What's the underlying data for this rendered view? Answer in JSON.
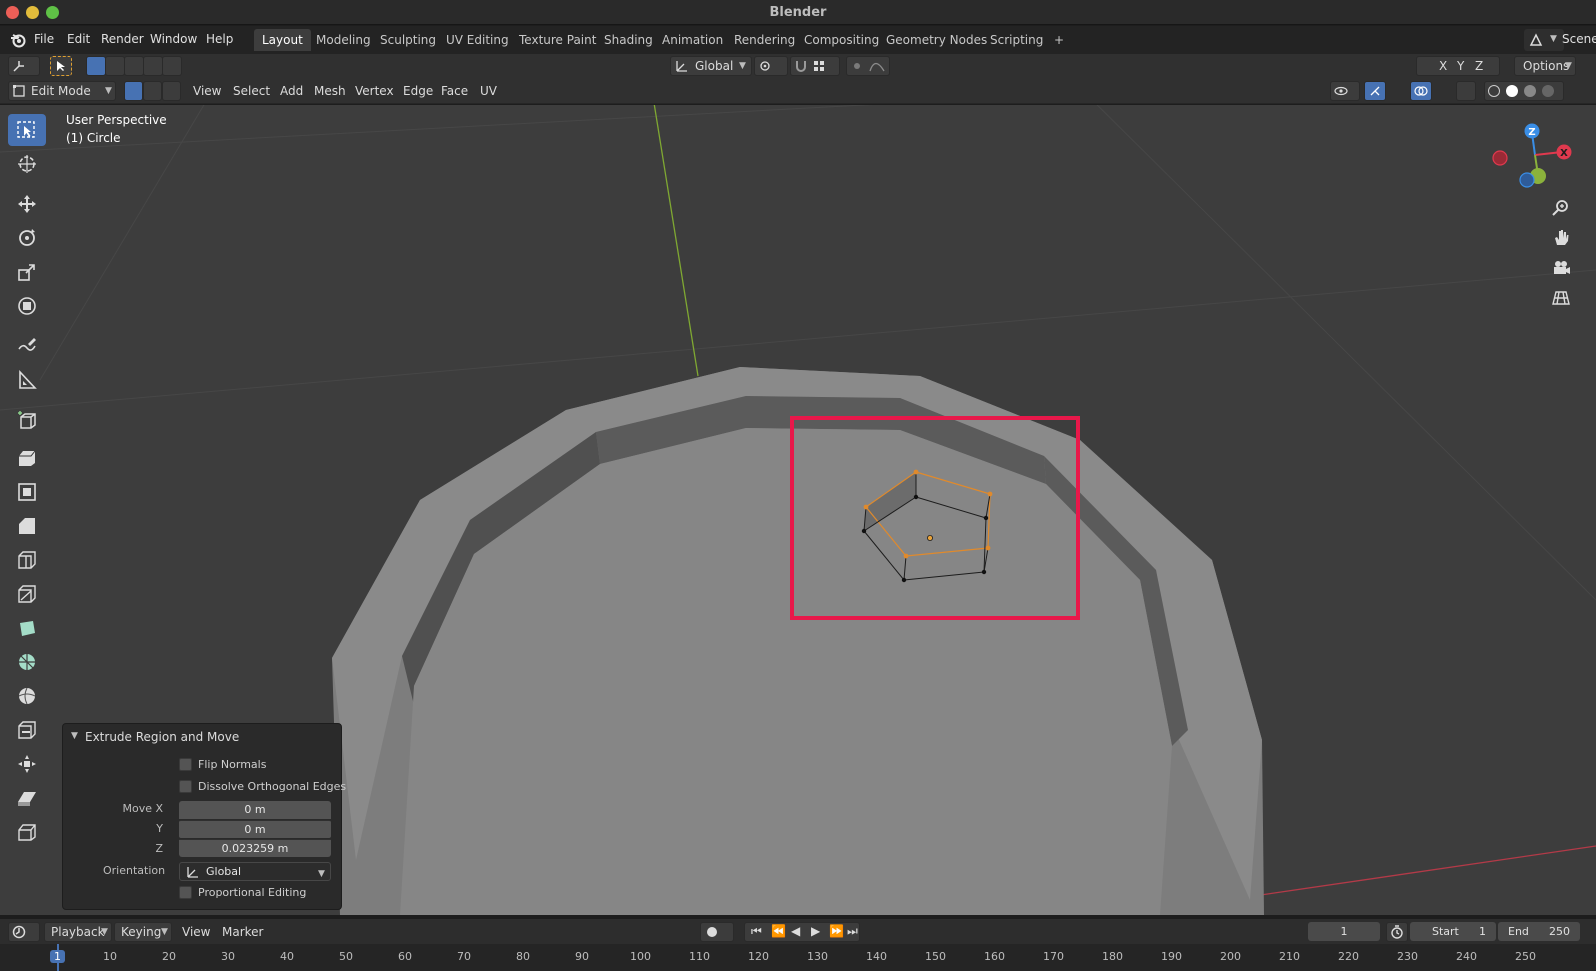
{
  "window": {
    "title": "Blender"
  },
  "menubar": {
    "menus": [
      "File",
      "Edit",
      "Render",
      "Window",
      "Help"
    ],
    "workspaces": [
      "Layout",
      "Modeling",
      "Sculpting",
      "UV Editing",
      "Texture Paint",
      "Shading",
      "Animation",
      "Rendering",
      "Compositing",
      "Geometry Nodes",
      "Scripting"
    ],
    "active_workspace": "Layout",
    "add_tab": "+",
    "scene": "Scene"
  },
  "tool_header": {
    "transform_orientation": "Global",
    "axes": [
      "X",
      "Y",
      "Z"
    ],
    "options": "Options"
  },
  "mode_header": {
    "mode": "Edit Mode",
    "menus": [
      "View",
      "Select",
      "Add",
      "Mesh",
      "Vertex",
      "Edge",
      "Face",
      "UV"
    ]
  },
  "viewport": {
    "perspective": "User Perspective",
    "object": "(1) Circle",
    "gizmo_axes": [
      "Z",
      "X"
    ],
    "highlight_color": "#e8184a"
  },
  "toolbar": {
    "tools": [
      "select-box",
      "cursor",
      "move",
      "rotate",
      "scale",
      "transform",
      "annotate",
      "measure",
      "add-cube",
      "extrude-region",
      "inset-faces",
      "bevel",
      "loop-cut",
      "knife",
      "poly-build",
      "spin",
      "smooth",
      "edge-slide",
      "shrink-fatten",
      "shear",
      "rip-region"
    ],
    "active_tool": "select-box"
  },
  "operator_panel": {
    "title": "Extrude Region and Move",
    "flip_normals": "Flip Normals",
    "dissolve": "Dissolve Orthogonal Edges",
    "move_x_label": "Move X",
    "move_x": "0 m",
    "y_label": "Y",
    "move_y": "0 m",
    "z_label": "Z",
    "move_z": "0.023259 m",
    "orientation_label": "Orientation",
    "orientation": "Global",
    "proportional": "Proportional Editing"
  },
  "timeline": {
    "menus": [
      "Playback",
      "Keying",
      "View",
      "Marker"
    ],
    "current_frame": "1",
    "start_label": "Start",
    "start": "1",
    "end_label": "End",
    "end": "250",
    "ticks": [
      "1",
      "10",
      "20",
      "30",
      "40",
      "50",
      "60",
      "70",
      "80",
      "90",
      "100",
      "110",
      "120",
      "130",
      "140",
      "150",
      "160",
      "170",
      "180",
      "190",
      "200",
      "210",
      "220",
      "230",
      "240",
      "250"
    ]
  },
  "colors": {
    "accent": "#4772b3",
    "selection_orange": "#e08a2c",
    "x_axis": "#e0394e",
    "y_axis": "#8bb23c",
    "z_axis": "#3a8ee6"
  }
}
